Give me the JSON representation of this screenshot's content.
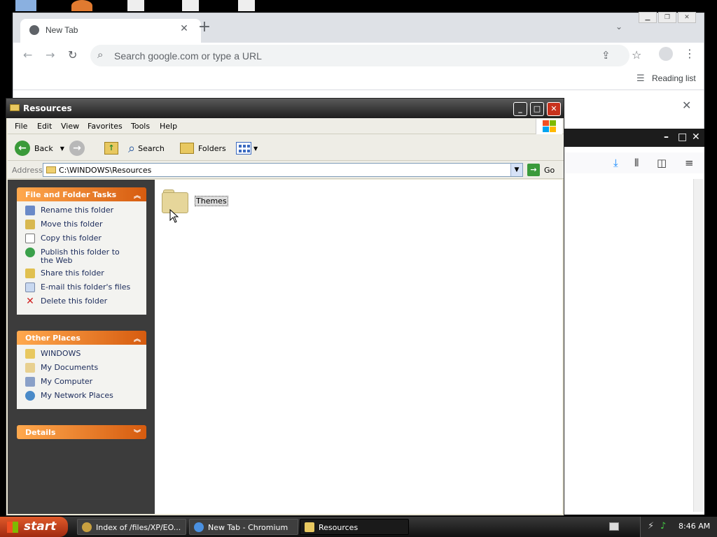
{
  "chromium": {
    "tab_title": "New Tab",
    "omnibox_placeholder": "Search google.com or type a URL",
    "reading_list_label": "Reading list"
  },
  "explorer": {
    "window_title": "Resources",
    "menu": [
      "File",
      "Edit",
      "View",
      "Favorites",
      "Tools",
      "Help"
    ],
    "toolbar": {
      "back_label": "Back",
      "search_label": "Search",
      "folders_label": "Folders"
    },
    "address": {
      "label": "Address",
      "value": "C:\\WINDOWS\\Resources",
      "go_label": "Go"
    },
    "tasks_panel": {
      "title": "File and Folder Tasks",
      "items": [
        "Rename this folder",
        "Move this folder",
        "Copy this folder",
        "Publish this folder to the Web",
        "Share this folder",
        "E-mail this folder's files",
        "Delete this folder"
      ]
    },
    "other_places_panel": {
      "title": "Other Places",
      "items": [
        "WINDOWS",
        "My Documents",
        "My Computer",
        "My Network Places"
      ]
    },
    "details_panel": {
      "title": "Details"
    },
    "files": [
      {
        "name": "Themes",
        "type": "folder",
        "selected": true
      }
    ]
  },
  "taskbar": {
    "start_label": "start",
    "items": [
      {
        "label": "Index of /files/XP/EO...",
        "active": false
      },
      {
        "label": "New Tab - Chromium",
        "active": false
      },
      {
        "label": "Resources",
        "active": true
      }
    ],
    "clock": "8:46 AM"
  },
  "colors": {
    "xp_panel_header": "#d65b0f",
    "xp_task_pane": "#3c3c3c",
    "taskbar_start": "#c0401a"
  }
}
